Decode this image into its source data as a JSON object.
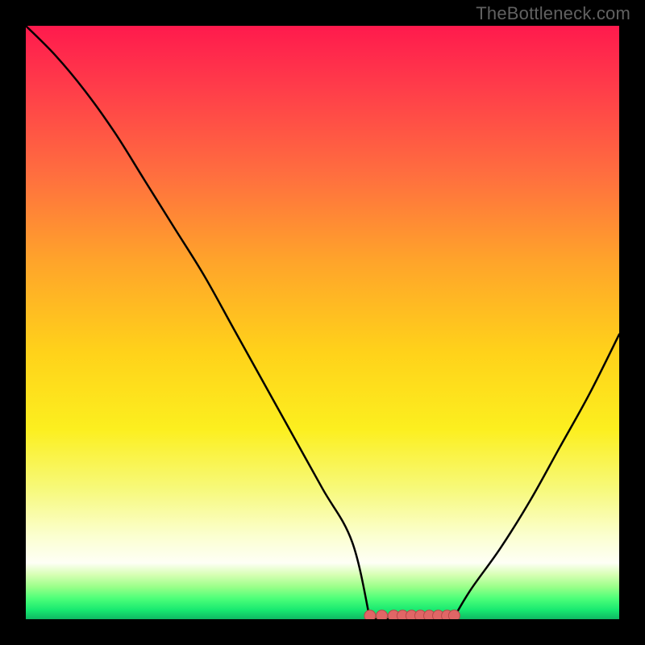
{
  "watermark": "TheBottleneck.com",
  "colors": {
    "page_bg": "#000000",
    "curve": "#000000",
    "marker_fill": "#e06666",
    "marker_stroke": "#b84a4a",
    "gradient_stops": [
      {
        "offset": 0.0,
        "color": "#ff1a4d"
      },
      {
        "offset": 0.1,
        "color": "#ff3b4a"
      },
      {
        "offset": 0.25,
        "color": "#ff6e3f"
      },
      {
        "offset": 0.4,
        "color": "#ffa52a"
      },
      {
        "offset": 0.55,
        "color": "#ffd21a"
      },
      {
        "offset": 0.68,
        "color": "#fcef1f"
      },
      {
        "offset": 0.78,
        "color": "#f7f97a"
      },
      {
        "offset": 0.86,
        "color": "#fbffd0"
      },
      {
        "offset": 0.905,
        "color": "#fefff6"
      },
      {
        "offset": 0.925,
        "color": "#d7ffb4"
      },
      {
        "offset": 0.945,
        "color": "#9cff8a"
      },
      {
        "offset": 0.965,
        "color": "#4dff79"
      },
      {
        "offset": 0.985,
        "color": "#17e870"
      },
      {
        "offset": 1.0,
        "color": "#0fb863"
      }
    ]
  },
  "chart_data": {
    "type": "line",
    "title": "",
    "xlabel": "",
    "ylabel": "",
    "xlim": [
      0,
      100
    ],
    "ylim": [
      0,
      100
    ],
    "series": [
      {
        "name": "bottleneck-curve",
        "x": [
          0,
          5,
          10,
          15,
          20,
          25,
          30,
          35,
          40,
          45,
          50,
          55,
          58,
          62,
          66,
          70,
          72,
          75,
          80,
          85,
          90,
          95,
          100
        ],
        "values": [
          100,
          95,
          89,
          82,
          74,
          66,
          58,
          49,
          40,
          31,
          22,
          13,
          7,
          2,
          0,
          0,
          2,
          5,
          12,
          20,
          29,
          38,
          48
        ]
      }
    ],
    "flat_region": {
      "x_start": 58,
      "x_end": 72,
      "y": 0
    },
    "markers": {
      "name": "optimal-range-markers",
      "x": [
        58.0,
        60.0,
        62.0,
        63.5,
        65.0,
        66.5,
        68.0,
        69.5,
        71.0,
        72.2
      ],
      "values": [
        0.2,
        0.1,
        0.0,
        0.0,
        0.0,
        0.0,
        0.0,
        0.1,
        0.2,
        0.6
      ]
    }
  }
}
